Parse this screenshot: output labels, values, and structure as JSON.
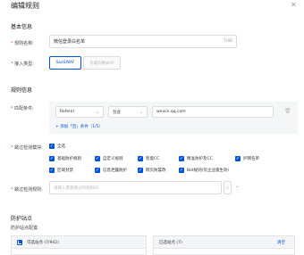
{
  "dialog": {
    "title": "编辑规则",
    "close_icon": "close-icon"
  },
  "basic": {
    "section_title": "基本信息",
    "rule_name_label": "规则名称:",
    "rule_name_value": "微信登录白名单",
    "rule_name_count": "7/40",
    "access_type_label": "接入类型:",
    "access_types": [
      "SaaSWAF",
      "负载均衡WAF"
    ]
  },
  "rule": {
    "section_title": "规则信息",
    "match_label": "匹配条件:",
    "field": "Referer",
    "operator": "包含",
    "value": "weixin.qq.com",
    "add_text": "添加「且」条件（1/5）",
    "skip_label": "跳过检测模块:",
    "modules": [
      "全选",
      "基础防护规则",
      "自定义规则",
      "智能CC",
      "精准防护及CC",
      "护网名单",
      "区域封禁",
      "信息泄露防护",
      "网页防篡改",
      "Bot规则(仅企业版生效)"
    ],
    "skip_rules_label": "跳过检测规则:",
    "skip_rules_placeholder": "请输入需要跳过的规则ID"
  },
  "protect": {
    "section_title": "防护站点",
    "config_label": "防护站点配置:",
    "available_label": "可选站点 (7/942)",
    "selected_label": "已选站点 (7)",
    "clear_label": "清空"
  }
}
